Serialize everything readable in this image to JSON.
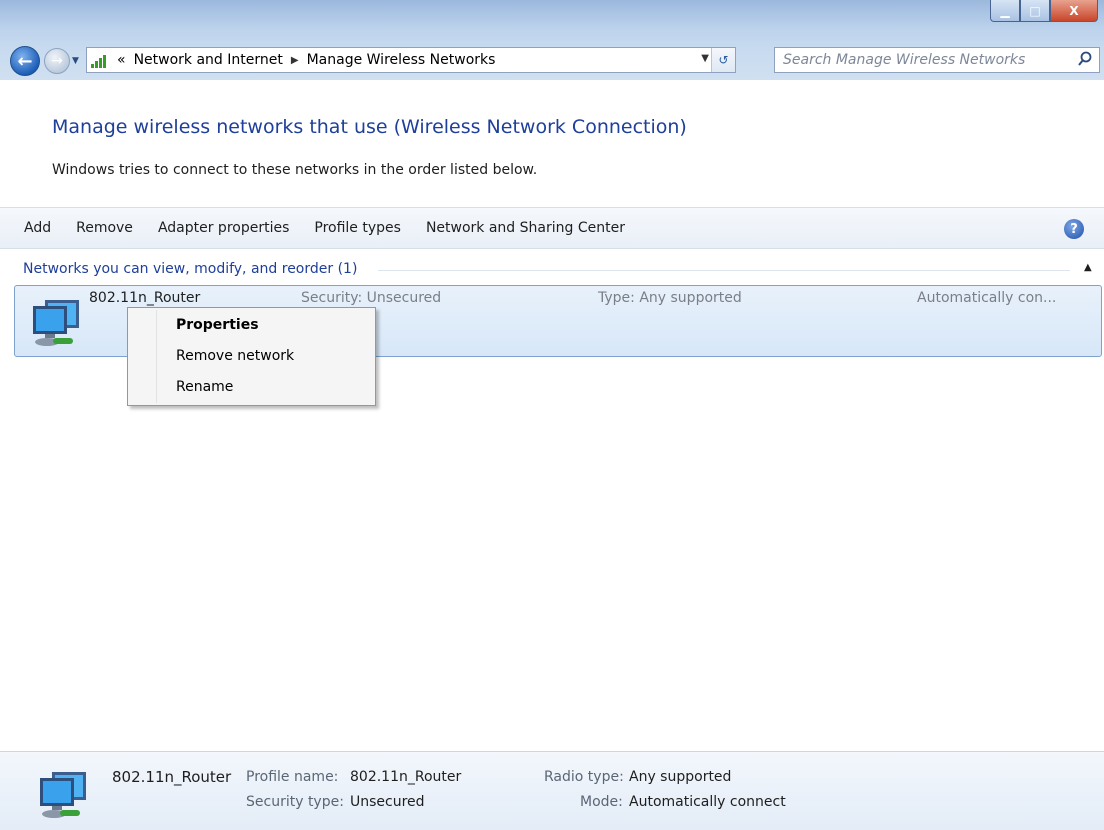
{
  "window": {
    "minimize_label": "▁",
    "maximize_label": "□",
    "close_label": "X"
  },
  "nav": {
    "address_overflow": "«",
    "breadcrumb": [
      "Network and Internet",
      "Manage Wireless Networks"
    ],
    "search_placeholder": "Search Manage Wireless Networks"
  },
  "header": {
    "title": "Manage wireless networks that use (Wireless Network Connection)",
    "subtitle": "Windows tries to connect to these networks in the order listed below."
  },
  "toolbar": {
    "items": [
      "Add",
      "Remove",
      "Adapter properties",
      "Profile types",
      "Network and Sharing Center"
    ],
    "help_label": "?"
  },
  "group": {
    "title": "Networks you can view, modify, and reorder (1)"
  },
  "network": {
    "name": "802.11n_Router",
    "security": "Security: Unsecured",
    "type": "Type: Any supported",
    "mode": "Automatically con..."
  },
  "context_menu": {
    "items": [
      "Properties",
      "Remove network",
      "Rename"
    ]
  },
  "details": {
    "name": "802.11n_Router",
    "profile_name_label": "Profile name:",
    "profile_name": "802.11n_Router",
    "security_type_label": "Security type:",
    "security_type": "Unsecured",
    "radio_type_label": "Radio type:",
    "radio_type": "Any supported",
    "mode_label": "Mode:",
    "mode": "Automatically connect"
  }
}
